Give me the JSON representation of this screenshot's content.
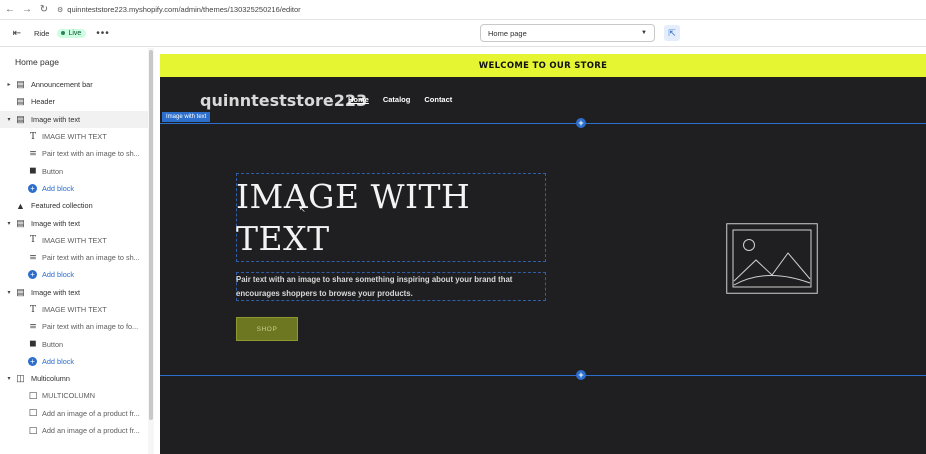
{
  "browser": {
    "url": "quinnteststore223.myshopify.com/admin/themes/130325250216/editor"
  },
  "editor": {
    "theme_name": "Ride",
    "status": "Live",
    "more": "•••",
    "page_selector": "Home page"
  },
  "sidebar": {
    "title": "Home page",
    "items": [
      {
        "label": "Announcement bar",
        "kind": "section",
        "icon": "section-icon",
        "chevron": "▸"
      },
      {
        "label": "Header",
        "kind": "section",
        "icon": "section-icon",
        "chevron": ""
      },
      {
        "label": "Image with text",
        "kind": "section",
        "icon": "image-with-text-icon",
        "chevron": "▾",
        "selected": true
      },
      {
        "label": "IMAGE WITH TEXT",
        "kind": "block",
        "icon": "text-icon"
      },
      {
        "label": "Pair text with an image to sh...",
        "kind": "block",
        "icon": "paragraph-icon"
      },
      {
        "label": "Button",
        "kind": "block",
        "icon": "button-icon"
      },
      {
        "label": "Add block",
        "kind": "add"
      },
      {
        "label": "Featured collection",
        "kind": "section",
        "icon": "collection-icon",
        "chevron": ""
      },
      {
        "label": "Image with text",
        "kind": "section",
        "icon": "image-with-text-icon",
        "chevron": "▾"
      },
      {
        "label": "IMAGE WITH TEXT",
        "kind": "block",
        "icon": "text-icon"
      },
      {
        "label": "Pair text with an image to sh...",
        "kind": "block",
        "icon": "paragraph-icon"
      },
      {
        "label": "Add block",
        "kind": "add"
      },
      {
        "label": "Image with text",
        "kind": "section",
        "icon": "image-with-text-icon",
        "chevron": "▾"
      },
      {
        "label": "IMAGE WITH TEXT",
        "kind": "block",
        "icon": "text-icon"
      },
      {
        "label": "Pair text with an image to fo...",
        "kind": "block",
        "icon": "paragraph-icon"
      },
      {
        "label": "Button",
        "kind": "block",
        "icon": "button-icon"
      },
      {
        "label": "Add block",
        "kind": "add"
      },
      {
        "label": "Multicolumn",
        "kind": "section",
        "icon": "multicolumn-icon",
        "chevron": "▾"
      },
      {
        "label": "MULTICOLUMN",
        "kind": "block",
        "icon": "column-icon"
      },
      {
        "label": "Add an image of a product fr...",
        "kind": "block",
        "icon": "column-icon"
      },
      {
        "label": "Add an image of a product fr...",
        "kind": "block",
        "icon": "column-icon"
      }
    ]
  },
  "preview": {
    "announcement": "WELCOME TO OUR STORE",
    "logo": "quinnteststore223",
    "nav": [
      "Home",
      "Catalog",
      "Contact"
    ],
    "section_tag": "Image with text",
    "heading": "IMAGE WITH TEXT",
    "body": "Pair text with an image to share something inspiring about your brand that encourages shoppers to browse your products.",
    "button": "SHOP"
  },
  "colors": {
    "accent": "#2c6ecb",
    "announcement_bg": "#e5f532",
    "preview_bg": "#1f1f21",
    "button_bg": "#6d7722"
  }
}
